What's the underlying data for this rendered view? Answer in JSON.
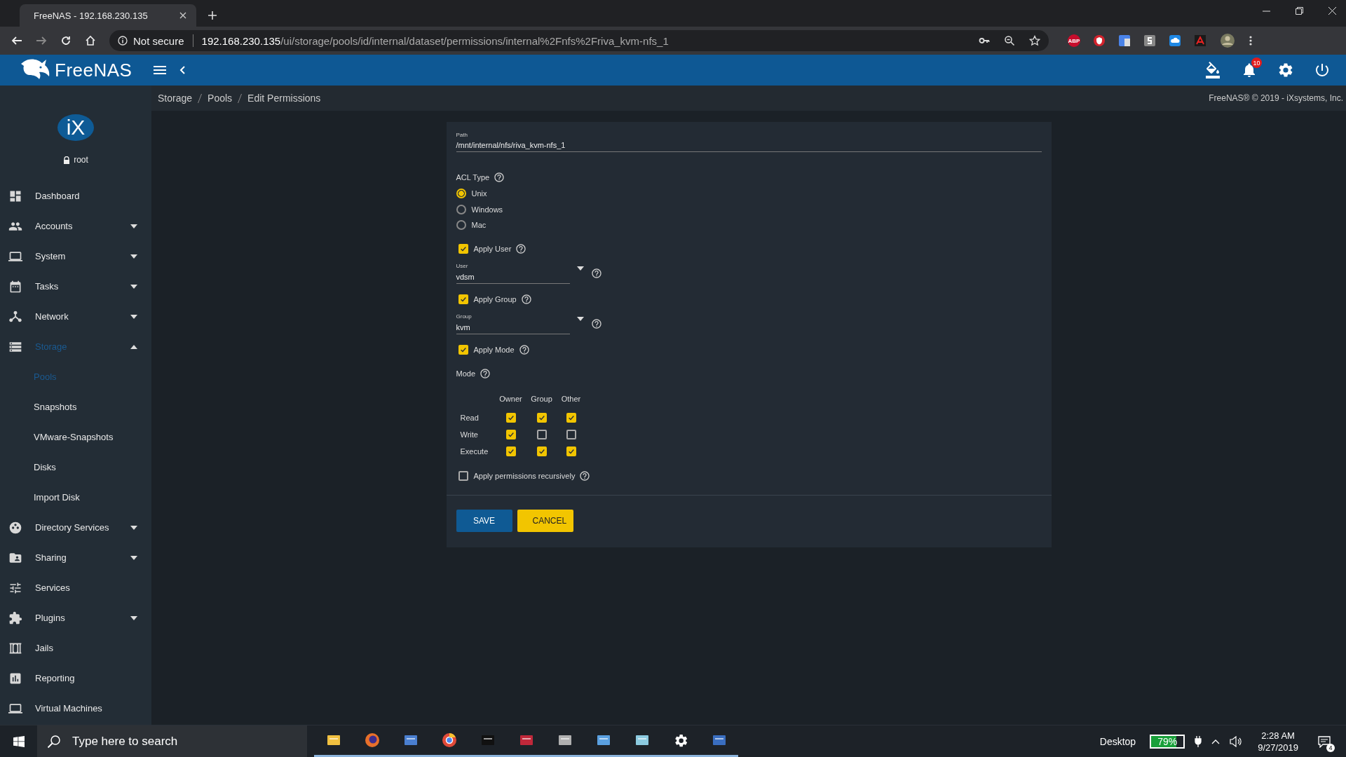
{
  "browser": {
    "tab_title": "FreeNAS - 192.168.230.135",
    "security": "Not secure",
    "url_host": "192.168.230.135",
    "url_path": "/ui/storage/pools/id/internal/dataset/permissions/internal%2Fnfs%2Friva_kvm-nfs_1",
    "abp_badge": "ABP"
  },
  "topbar": {
    "logo": "FreeNAS",
    "notification_count": "10"
  },
  "breadcrumb": [
    "Storage",
    "Pools",
    "Edit Permissions"
  ],
  "copyright": "FreeNAS® © 2019 - iXsystems, Inc.",
  "sidebar": {
    "logo": "iX",
    "user": "root",
    "items": [
      {
        "label": "Dashboard",
        "expandable": false,
        "selected": false
      },
      {
        "label": "Accounts",
        "expandable": true,
        "expanded": false,
        "selected": false
      },
      {
        "label": "System",
        "expandable": true,
        "expanded": false,
        "selected": false
      },
      {
        "label": "Tasks",
        "expandable": true,
        "expanded": false,
        "selected": false
      },
      {
        "label": "Network",
        "expandable": true,
        "expanded": false,
        "selected": false
      },
      {
        "label": "Storage",
        "expandable": true,
        "expanded": true,
        "selected": true,
        "children": [
          {
            "label": "Pools",
            "selected": true
          },
          {
            "label": "Snapshots",
            "selected": false
          },
          {
            "label": "VMware-Snapshots",
            "selected": false
          },
          {
            "label": "Disks",
            "selected": false
          },
          {
            "label": "Import Disk",
            "selected": false
          }
        ]
      },
      {
        "label": "Directory Services",
        "expandable": true,
        "expanded": false,
        "selected": false
      },
      {
        "label": "Sharing",
        "expandable": true,
        "expanded": false,
        "selected": false
      },
      {
        "label": "Services",
        "expandable": false,
        "selected": false
      },
      {
        "label": "Plugins",
        "expandable": true,
        "expanded": false,
        "selected": false
      },
      {
        "label": "Jails",
        "expandable": false,
        "selected": false
      },
      {
        "label": "Reporting",
        "expandable": false,
        "selected": false
      },
      {
        "label": "Virtual Machines",
        "expandable": false,
        "selected": false
      }
    ]
  },
  "form": {
    "path": {
      "label": "Path",
      "value": "/mnt/internal/nfs/riva_kvm-nfs_1"
    },
    "acl_type": {
      "label": "ACL Type",
      "options": [
        {
          "label": "Unix",
          "selected": true
        },
        {
          "label": "Windows",
          "selected": false
        },
        {
          "label": "Mac",
          "selected": false
        }
      ]
    },
    "apply_user": {
      "label": "Apply User",
      "checked": true
    },
    "user": {
      "label": "User",
      "value": "vdsm"
    },
    "apply_group": {
      "label": "Apply Group",
      "checked": true
    },
    "group": {
      "label": "Group",
      "value": "kvm"
    },
    "apply_mode": {
      "label": "Apply Mode",
      "checked": true
    },
    "mode": {
      "label": "Mode",
      "columns": [
        "Owner",
        "Group",
        "Other"
      ],
      "rows": [
        {
          "label": "Read",
          "checks": [
            true,
            true,
            true
          ]
        },
        {
          "label": "Write",
          "checks": [
            true,
            false,
            false
          ]
        },
        {
          "label": "Execute",
          "checks": [
            true,
            true,
            true
          ]
        }
      ]
    },
    "recursive": {
      "label": "Apply permissions recursively",
      "checked": false
    },
    "buttons": [
      "SAVE",
      "CANCEL"
    ]
  },
  "taskbar": {
    "search_placeholder": "Type here to search",
    "apps": [
      {
        "running": true
      },
      {
        "running": true
      },
      {
        "running": true
      },
      {
        "running": true
      },
      {
        "running": true
      },
      {
        "running": true
      },
      {
        "running": true
      },
      {
        "running": true
      },
      {
        "running": true
      },
      {
        "running": true
      },
      {
        "running": true
      }
    ],
    "desktop": "Desktop",
    "battery": {
      "reading": "79%",
      "level": 0.79
    },
    "time": "2:28 AM",
    "date": "9/27/2019",
    "notification_count": "4"
  }
}
